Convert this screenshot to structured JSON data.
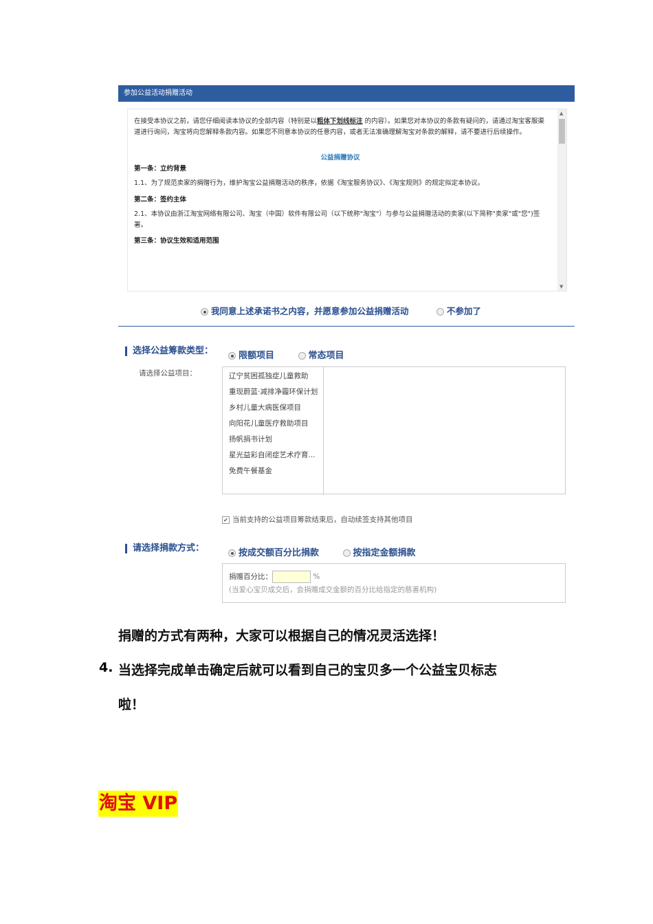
{
  "window": {
    "title": "参加公益活动捐赠活动"
  },
  "agreement": {
    "intro_before": "在接受本协议之前，请您仔细阅读本协议的全部内容（特别是以",
    "intro_bold": "粗体下划线标注",
    "intro_after": "的内容）。如果您对本协议的条款有疑问的，请通过淘宝客服渠道进行询问，淘宝将向您解释条款内容。如果您不同意本协议的任意内容，或者无法准确理解淘宝对条款的解释，请不要进行后续操作。",
    "title": "公益捐赠协议",
    "h1": "第一条：立约背景",
    "p1": "1.1、为了规范卖家的捐赠行为，维护淘宝公益捐赠活动的秩序，依据《淘宝服务协议》、《淘宝规则》的规定拟定本协议。",
    "h2": "第二条：签约主体",
    "p2": "2.1、本协议由浙江淘宝网络有限公司、淘宝（中国）软件有限公司（以下统称\"淘宝\"）与参与公益捐赠活动的卖家(以下简称\"卖家\"或\"您\")签署。",
    "h3": "第三条：协议生效和适用范围",
    "agree_option": "我同意上述承诺书之内容，并愿意参加公益捐赠活动",
    "decline_option": "不参加了"
  },
  "fund_type": {
    "label": "选择公益筹款类型：",
    "options": [
      "限额项目",
      "常态项目"
    ],
    "selected": 0,
    "project_label": "请选择公益项目：",
    "projects": [
      "辽宁贫困孤独症儿童救助",
      "重现蔚蓝·减排净霾环保计划",
      "乡村儿童大病医保项目",
      "向阳花儿童医疗救助项目",
      "扬帆捐书计划",
      "星光益彩自闭症艺术疗育...",
      "免费午餐基金"
    ],
    "auto_renew": "当前支持的公益项目筹款结束后，自动续签支持其他项目",
    "auto_renew_checked": true
  },
  "donation": {
    "label": "请选择捐款方式：",
    "options": [
      "按成交额百分比捐款",
      "按指定金额捐款"
    ],
    "selected": 0,
    "pct_label": "捐赠百分比：",
    "pct_value": "",
    "pct_unit": "%",
    "hint": "(当爱心宝贝成交后，会捐赠成交金额的百分比给指定的慈善机构)"
  },
  "doc": {
    "line1": "捐赠的方式有两种，大家可以根据自己的情况灵活选择！",
    "step_num": "4.",
    "line2": "当选择完成单击确定后就可以看到自己的宝贝多一个公益宝贝标志",
    "line3": "啦！",
    "footer": "淘宝 VIP"
  }
}
